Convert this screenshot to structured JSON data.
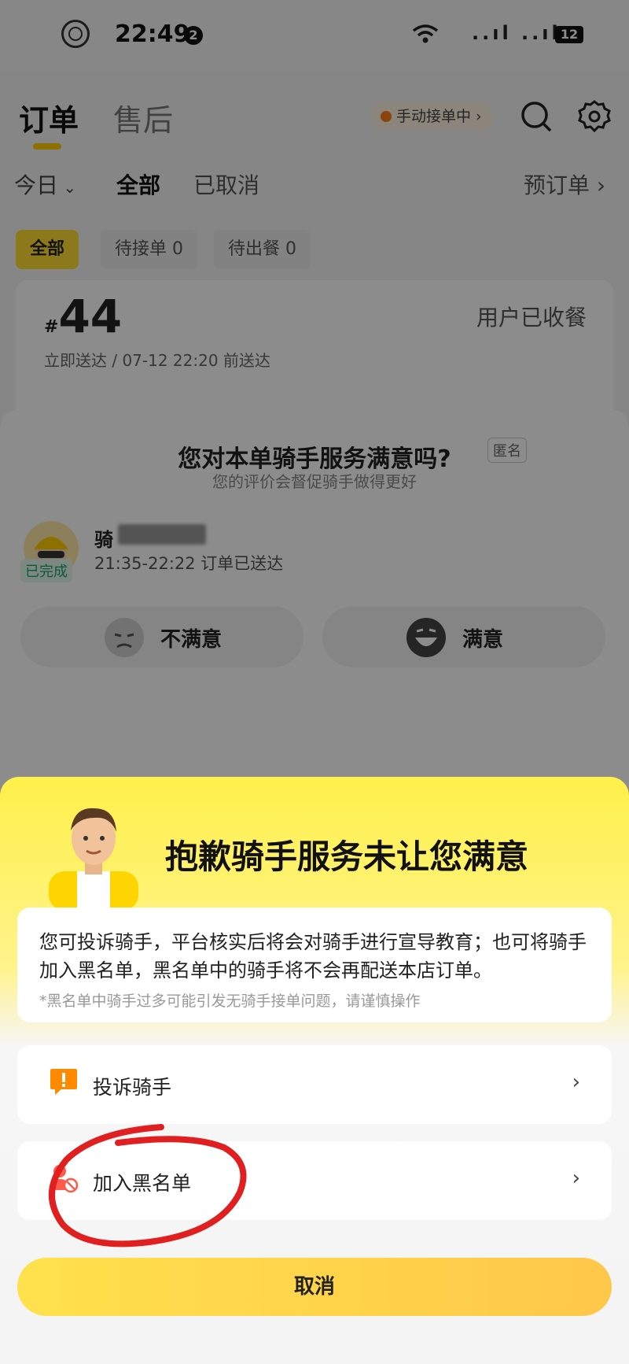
{
  "status_bar": {
    "time": "22:49",
    "notif_count": "2",
    "signal": "..ıl ..ıl",
    "battery": "12"
  },
  "header": {
    "tab_order": "订单",
    "tab_after_sales": "售后",
    "manual_accept": "手动接单中 ›"
  },
  "filters": {
    "today": "今日",
    "all": "全部",
    "cancelled": "已取消",
    "preorder": "预订单 ›"
  },
  "sub_tabs": [
    {
      "label": "全部"
    },
    {
      "label": "待接单 0"
    },
    {
      "label": "待出餐 0"
    }
  ],
  "order": {
    "hash": "#",
    "number": "44",
    "state": "用户已收餐",
    "time": "立即送达 / 07-12 22:20 前送达"
  },
  "rating": {
    "title": "您对本单骑手服务满意吗?",
    "anonymous": "匿名",
    "subtitle": "您的评价会督促骑手做得更好",
    "rider_name_prefix": "骑",
    "rider_status": "已完成",
    "rider_time": "21:35-22:22 订单已送达",
    "dissatisfied": "不满意",
    "satisfied": "满意"
  },
  "sheet": {
    "title": "抱歉骑手服务未让您满意",
    "info": "您可投诉骑手，平台核实后将会对骑手进行宣导教育；也可将骑手加入黑名单，黑名单中的骑手将不会再配送本店订单。",
    "note": "*黑名单中骑手过多可能引发无骑手接单问题，请谨慎操作",
    "options": [
      {
        "label": "投诉骑手",
        "icon": "complaint-icon"
      },
      {
        "label": "加入黑名单",
        "icon": "blacklist-icon"
      }
    ],
    "cancel": "取消"
  },
  "colors": {
    "accent": "#ffdd33",
    "annotation": "#e02020"
  }
}
